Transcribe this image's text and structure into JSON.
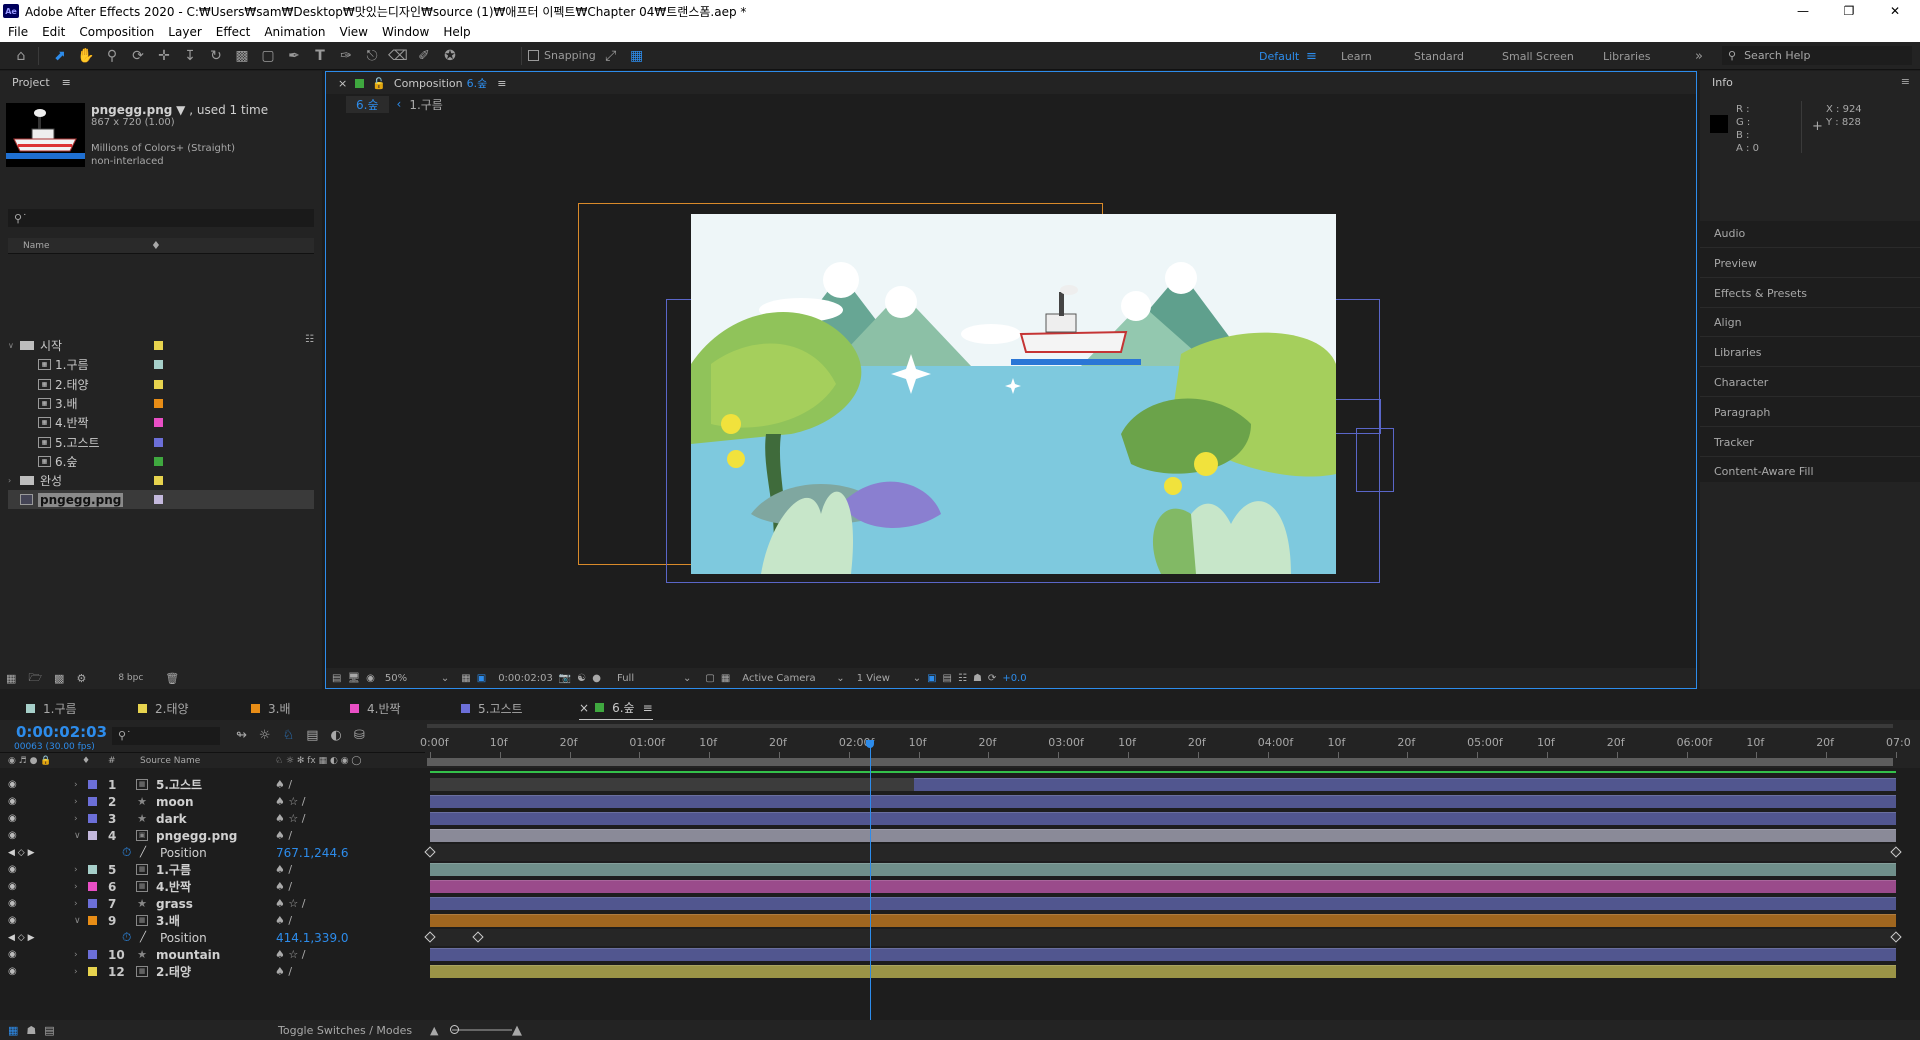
{
  "window": {
    "title": "Adobe After Effects 2020 - C:₩Users₩sam₩Desktop₩맛있는디자인₩source (1)₩애프터 이펙트₩Chapter 04₩트랜스폼.aep *",
    "app_icon": "Ae"
  },
  "menu": [
    "File",
    "Edit",
    "Composition",
    "Layer",
    "Effect",
    "Animation",
    "View",
    "Window",
    "Help"
  ],
  "toolbar": {
    "snapping": "Snapping",
    "workspaces": [
      "Default",
      "Learn",
      "Standard",
      "Small Screen",
      "Libraries"
    ],
    "search_placeholder": "Search Help"
  },
  "project": {
    "title": "Project",
    "item_name": "pngegg.png",
    "item_used": ", used 1 time",
    "item_dims": "867 x 720 (1.00)",
    "item_colors": "Millions of Colors+ (Straight)",
    "item_interlace": "non-interlaced",
    "search_placeholder": "",
    "col_name": "Name",
    "bpc": "8 bpc",
    "items": [
      {
        "label": "시작",
        "type": "folder",
        "color": "#e7d34e",
        "open": true
      },
      {
        "label": "1.구름",
        "type": "comp",
        "color": "#a6cfc9"
      },
      {
        "label": "2.태양",
        "type": "comp",
        "color": "#e7d34e"
      },
      {
        "label": "3.배",
        "type": "comp",
        "color": "#e88d16"
      },
      {
        "label": "4.반짝",
        "type": "comp",
        "color": "#e94fc5"
      },
      {
        "label": "5.고스트",
        "type": "comp",
        "color": "#6c6fd8"
      },
      {
        "label": "6.숲",
        "type": "comp",
        "color": "#3fa83f"
      },
      {
        "label": "완성",
        "type": "folder",
        "color": "#e7d34e",
        "open": false
      },
      {
        "label": "pngegg.png",
        "type": "image",
        "color": "#c3b8dc",
        "selected": true
      }
    ]
  },
  "composition": {
    "tab_label": "Composition",
    "tab_name": "6.숲",
    "crumb_active": "6.숲",
    "crumb_next": "1.구름",
    "zoom": "50%",
    "time": "0:00:02:03",
    "resolution": "Full",
    "camera": "Active Camera",
    "views": "1 View",
    "exposure": "+0.0"
  },
  "info": {
    "title": "Info",
    "r": "R :",
    "g": "G :",
    "b": "B :",
    "a": "A :  0",
    "x": "X : 924",
    "y": "Y : 828"
  },
  "right_panels": [
    "Audio",
    "Preview",
    "Effects & Presets",
    "Align",
    "Libraries",
    "Character",
    "Paragraph",
    "Tracker",
    "Content-Aware Fill"
  ],
  "timeline": {
    "tabs": [
      {
        "label": "1.구름",
        "color": "#a6cfc9"
      },
      {
        "label": "2.태양",
        "color": "#e7d34e"
      },
      {
        "label": "3.배",
        "color": "#e88d16"
      },
      {
        "label": "4.반짝",
        "color": "#e94fc5"
      },
      {
        "label": "5.고스트",
        "color": "#6c6fd8"
      },
      {
        "label": "6.숲",
        "color": "#3fa83f",
        "active": true
      }
    ],
    "current_time": "0:00:02:03",
    "frame_info": "00063 (30.00 fps)",
    "col_source": "Source Name",
    "col_hash": "#",
    "ruler": [
      "0:00f",
      "10f",
      "20f",
      "01:00f",
      "10f",
      "20f",
      "02:00f",
      "10f",
      "20f",
      "03:00f",
      "10f",
      "20f",
      "04:00f",
      "10f",
      "20f",
      "05:00f",
      "10f",
      "20f",
      "06:00f",
      "10f",
      "20f",
      "07:0"
    ],
    "playhead_fraction": 0.3,
    "layers": [
      {
        "num": "1",
        "name": "5.고스트",
        "type": "comp",
        "color": "#6c6fd8",
        "bar": "#51568f",
        "bar_start": 0.33,
        "open": false
      },
      {
        "num": "2",
        "name": "moon",
        "type": "shape",
        "color": "#6c6fd8",
        "bar": "#51568f",
        "bar_start": 0,
        "open": false
      },
      {
        "num": "3",
        "name": "dark",
        "type": "shape",
        "color": "#6c6fd8",
        "bar": "#51568f",
        "bar_start": 0,
        "open": false
      },
      {
        "num": "4",
        "name": "pngegg.png",
        "type": "image",
        "color": "#c3b8dc",
        "bar": "#8a8a98",
        "bar_start": 0,
        "open": true,
        "prop": "Position",
        "prop_value": "767.1,244.6",
        "keys": [
          0,
          1
        ]
      },
      {
        "num": "5",
        "name": "1.구름",
        "type": "comp",
        "color": "#a6cfc9",
        "bar": "#6f8f8a",
        "bar_start": 0,
        "open": false
      },
      {
        "num": "6",
        "name": "4.반짝",
        "type": "comp",
        "color": "#e94fc5",
        "bar": "#9a4b8b",
        "bar_start": 0,
        "open": false
      },
      {
        "num": "7",
        "name": "grass",
        "type": "shape",
        "color": "#6c6fd8",
        "bar": "#51568f",
        "bar_start": 0,
        "open": false
      },
      {
        "num": "9",
        "name": "3.배",
        "type": "comp",
        "color": "#e88d16",
        "bar": "#a0661f",
        "bar_start": 0,
        "open": true,
        "prop": "Position",
        "prop_value": "414.1,339.0",
        "keys": [
          0,
          0.033,
          1
        ]
      },
      {
        "num": "10",
        "name": "mountain",
        "type": "shape",
        "color": "#6c6fd8",
        "bar": "#51568f",
        "bar_start": 0,
        "open": false
      },
      {
        "num": "12",
        "name": "2.태양",
        "type": "comp",
        "color": "#e7d34e",
        "bar": "#9b9447",
        "bar_start": 0,
        "open": false
      }
    ],
    "toggle_label": "Toggle Switches / Modes"
  }
}
